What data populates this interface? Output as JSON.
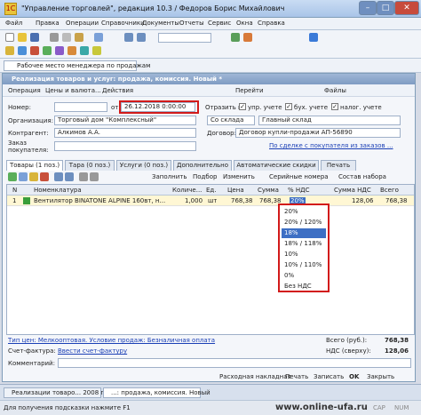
{
  "window": {
    "title": "\"Управление торговлей\", редакция 10.3 / Федоров Борис Михайлович",
    "app_icon": "1С"
  },
  "menu": [
    "Файл",
    "Правка",
    "Операции",
    "Справочники",
    "Документы",
    "Отчеты",
    "Сервис",
    "Окна",
    "Справка"
  ],
  "top_tab": {
    "label": "Рабочее место менеджера по продажам"
  },
  "doc": {
    "title": "Реализация товаров и услуг: продажа, комиссия. Новый *",
    "toolbar": {
      "operation": "Операция",
      "prices_currency": "Цены и валюта...",
      "actions": "Действия",
      "goto": "Перейти",
      "files": "Файлы"
    },
    "fields": {
      "number_label": "Номер:",
      "number_value": "",
      "from_label": "от:",
      "date_value": "26.12.2018  0:00:00",
      "reflect_label": "Отразить в:",
      "upr_label": "упр. учете",
      "buh_label": "бух. учете",
      "tax_label": "налог. учете",
      "org_label": "Организация:",
      "org_value": "Торговый дом \"Комплексный\"",
      "ship_type": "Со склада",
      "warehouse": "Главный склад",
      "contractor_label": "Контрагент:",
      "contractor_value": "Алкимов А.А.",
      "contract_label": "Договор:",
      "contract_value": "Договор купли-продажи АП-56890",
      "order_label": "Заказ покупателя:",
      "commission_link": "По сделке с покупателя из заказов ..."
    },
    "tabs": [
      "Товары (1 поз.)",
      "Тара (0 поз.)",
      "Услуги (0 поз.)",
      "Дополнительно",
      "Автоматические скидки",
      "Печать"
    ],
    "grid_toolbar": {
      "fill": "Заполнить",
      "select": "Подбор",
      "change": "Изменить",
      "serial": "Серийные номера",
      "kit": "Состав набора"
    },
    "grid": {
      "columns": [
        "N",
        "Номенклатура",
        "Количе...",
        "Ед.",
        "Цена",
        "Сумма",
        "% НДС",
        "Сумма НДС",
        "Всего"
      ],
      "rows": [
        {
          "n": "1",
          "name": "Вентилятор BINATONE ALPINE 160вт, н...",
          "qty": "1,000",
          "unit": "шт",
          "price": "768,38",
          "sum": "768,38",
          "vat": "20%",
          "vat_sum": "128,06",
          "total": "768,38"
        }
      ]
    },
    "vat_options": [
      "20%",
      "20% / 120%",
      "18%",
      "18% / 118%",
      "10%",
      "10% / 110%",
      "0%",
      "Без НДС"
    ],
    "vat_selected": "18%",
    "footer": {
      "price_type_link": "Тип цен: Мелкооптовая. Условие продаж: Безналичная оплата",
      "total_label": "Всего (руб.):",
      "total_value": "768,38",
      "vat_label": "НДС (сверху):",
      "vat_value": "128,06",
      "invoice_label": "Счет-фактура:",
      "invoice_link": "Ввести счет-фактуру",
      "comment_label": "Комментарий:",
      "comment_value": ""
    },
    "buttons": {
      "consignment": "Расходная накладная",
      "print": "Печать",
      "record": "Записать",
      "ok": "OK",
      "close": "Закрыть"
    }
  },
  "taskbar": [
    {
      "label": "Реализации товаро... 2008 г."
    },
    {
      "label": "...: продажа, комиссия. Новый"
    }
  ],
  "status": {
    "hint": "Для получения подсказки нажмите F1",
    "watermark": "www.online-ufa.ru",
    "cap": "CAP",
    "num": "NUM"
  }
}
